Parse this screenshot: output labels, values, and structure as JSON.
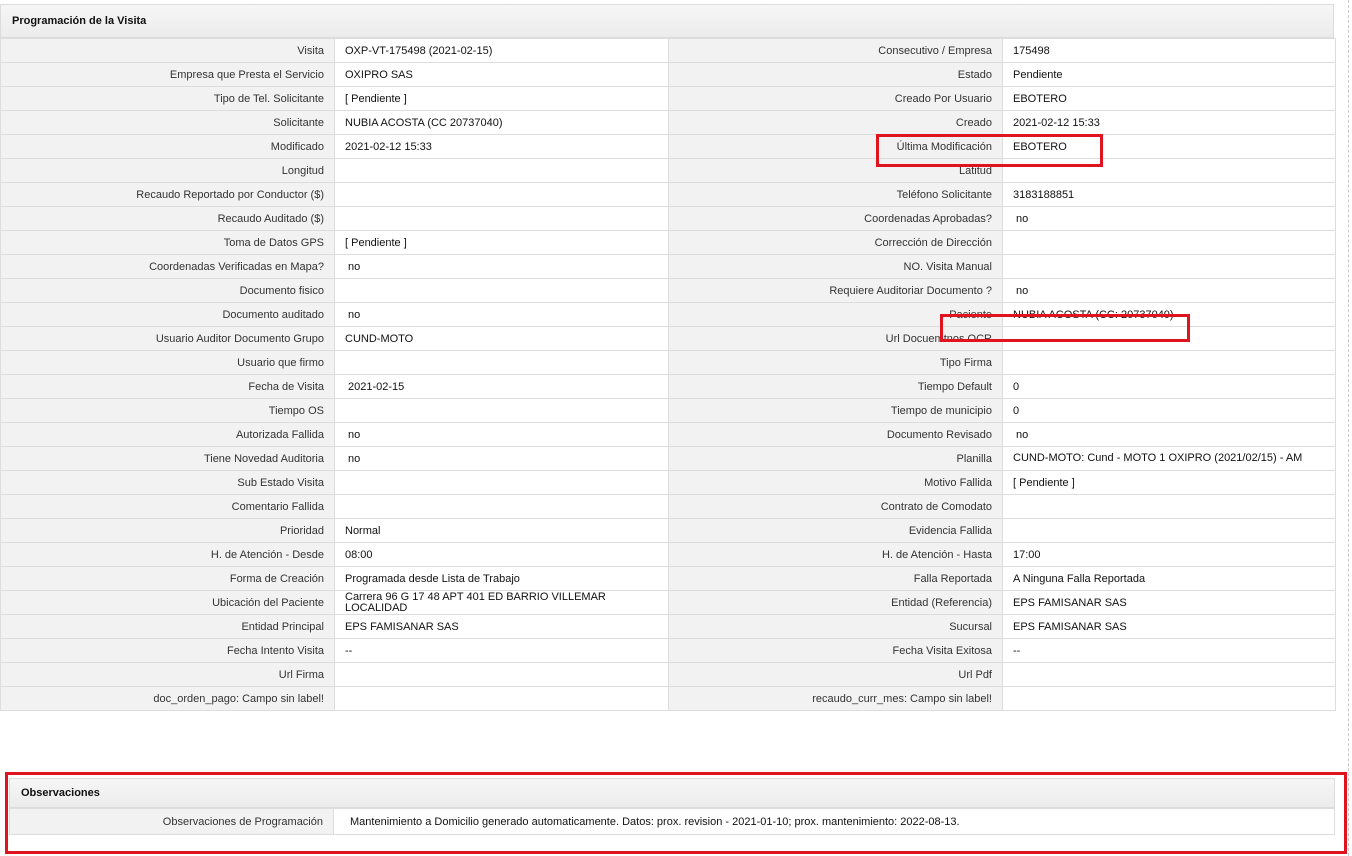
{
  "programacion": {
    "title": "Programación de la Visita",
    "rows": [
      {
        "l1": "Visita",
        "v1": "OXP-VT-175498 (2021-02-15)",
        "l2": "Consecutivo / Empresa",
        "v2": "175498"
      },
      {
        "l1": "Empresa que Presta el Servicio",
        "v1": "OXIPRO SAS",
        "l2": "Estado",
        "v2": "Pendiente"
      },
      {
        "l1": "Tipo de Tel. Solicitante",
        "v1": "[ Pendiente ]",
        "l2": "Creado Por Usuario",
        "v2": "EBOTERO"
      },
      {
        "l1": "Solicitante",
        "v1": "NUBIA ACOSTA (CC 20737040)",
        "l2": "Creado",
        "v2": "2021-02-12 15:33"
      },
      {
        "l1": "Modificado",
        "v1": "2021-02-12 15:33",
        "l2": "Última Modificación",
        "v2": "EBOTERO"
      },
      {
        "l1": "Longitud",
        "v1": "",
        "l2": "Latitud",
        "v2": ""
      },
      {
        "l1": "Recaudo Reportado por Conductor ($)",
        "v1": "",
        "l2": "Teléfono Solicitante",
        "v2": "3183188851"
      },
      {
        "l1": "Recaudo Auditado ($)",
        "v1": "",
        "l2": "Coordenadas Aprobadas?",
        "v2": "no"
      },
      {
        "l1": "Toma de Datos GPS",
        "v1": "[ Pendiente ]",
        "l2": "Corrección de Dirección",
        "v2": ""
      },
      {
        "l1": "Coordenadas Verificadas en Mapa?",
        "v1": "no",
        "l2": "NO. Visita Manual",
        "v2": ""
      },
      {
        "l1": "Documento fisico",
        "v1": "",
        "l2": "Requiere Auditoriar Documento ?",
        "v2": "no"
      },
      {
        "l1": "Documento auditado",
        "v1": "no",
        "l2": "Paciente",
        "v2": "NUBIA ACOSTA (CC: 20737040)"
      },
      {
        "l1": "Usuario Auditor Documento Grupo",
        "v1": "CUND-MOTO",
        "l2": "Url Docuemtnos OCR",
        "v2": ""
      },
      {
        "l1": "Usuario que firmo",
        "v1": "",
        "l2": "Tipo Firma",
        "v2": ""
      },
      {
        "l1": "Fecha de Visita",
        "v1": "2021-02-15",
        "l2": "Tiempo Default",
        "v2": "0"
      },
      {
        "l1": "Tiempo OS",
        "v1": "",
        "l2": "Tiempo de municipio",
        "v2": "0"
      },
      {
        "l1": "Autorizada Fallida",
        "v1": "no",
        "l2": "Documento Revisado",
        "v2": "no"
      },
      {
        "l1": "Tiene Novedad Auditoria",
        "v1": "no",
        "l2": "Planilla",
        "v2": "CUND-MOTO: Cund - MOTO 1 OXIPRO (2021/02/15) - AM"
      },
      {
        "l1": "Sub Estado Visita",
        "v1": "",
        "l2": "Motivo Fallida",
        "v2": "[ Pendiente ]"
      },
      {
        "l1": "Comentario Fallida",
        "v1": "",
        "l2": "Contrato de Comodato",
        "v2": ""
      },
      {
        "l1": "Prioridad",
        "v1": "Normal",
        "l2": "Evidencia Fallida",
        "v2": ""
      },
      {
        "l1": "H. de Atención - Desde",
        "v1": "08:00",
        "l2": "H. de Atención - Hasta",
        "v2": "17:00"
      },
      {
        "l1": "Forma de Creación",
        "v1": "Programada desde Lista de Trabajo",
        "l2": "Falla Reportada",
        "v2": "A Ninguna Falla Reportada"
      },
      {
        "l1": "Ubicación del Paciente",
        "v1": "Carrera 96 G 17 48 APT 401 ED BARRIO VILLEMAR LOCALIDAD",
        "l2": "Entidad (Referencia)",
        "v2": "EPS FAMISANAR SAS"
      },
      {
        "l1": "Entidad Principal",
        "v1": "EPS FAMISANAR SAS",
        "l2": "Sucursal",
        "v2": "EPS FAMISANAR SAS"
      },
      {
        "l1": "Fecha Intento Visita",
        "v1": "--",
        "l2": "Fecha Visita Exitosa",
        "v2": "--"
      },
      {
        "l1": "Url Firma",
        "v1": "",
        "l2": "Url Pdf",
        "v2": ""
      },
      {
        "l1": "doc_orden_pago: Campo sin label!",
        "v1": "",
        "l2": "recaudo_curr_mes: Campo sin label!",
        "v2": ""
      }
    ]
  },
  "observaciones": {
    "title": "Observaciones",
    "label": "Observaciones de Programación",
    "value": "Mantenimiento a Domicilio generado automaticamente. Datos: prox. revision - 2021-01-10; prox. mantenimiento: 2022-08-13."
  },
  "highlight_color": "#e0141e"
}
